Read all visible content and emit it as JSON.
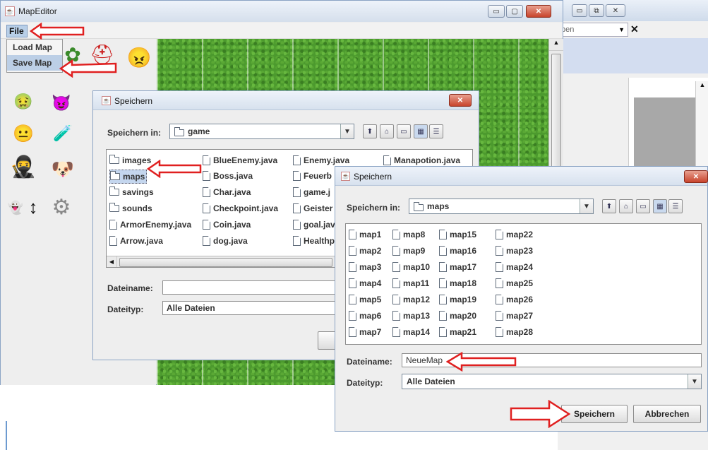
{
  "main_window": {
    "title": "MapEditor",
    "menu": {
      "file_label": "File",
      "items": [
        "Load Map",
        "Save Map"
      ]
    },
    "buttons": {
      "minimize": "▭",
      "maximize": "▢",
      "close": "✕"
    }
  },
  "background_window": {
    "combo_text": "ben",
    "buttons": {
      "minimize": "▭",
      "restore": "⧉",
      "close": "✕"
    }
  },
  "dialog1": {
    "title": "Speichern",
    "save_in_label": "Speichern in:",
    "save_in_value": "game",
    "files": [
      {
        "name": "images",
        "type": "folder"
      },
      {
        "name": "maps",
        "type": "folder"
      },
      {
        "name": "savings",
        "type": "folder"
      },
      {
        "name": "sounds",
        "type": "folder"
      },
      {
        "name": "ArmorEnemy.java",
        "type": "file"
      },
      {
        "name": "Arrow.java",
        "type": "file"
      },
      {
        "name": "BlueEnemy.java",
        "type": "file"
      },
      {
        "name": "Boss.java",
        "type": "file"
      },
      {
        "name": "Char.java",
        "type": "file"
      },
      {
        "name": "Checkpoint.java",
        "type": "file"
      },
      {
        "name": "Coin.java",
        "type": "file"
      },
      {
        "name": "dog.java",
        "type": "file"
      },
      {
        "name": "Enemy.java",
        "type": "file"
      },
      {
        "name": "Feuerb",
        "type": "file"
      },
      {
        "name": "game.j",
        "type": "file"
      },
      {
        "name": "Geister",
        "type": "file"
      },
      {
        "name": "goal.jav",
        "type": "file"
      },
      {
        "name": "Healthp",
        "type": "file"
      },
      {
        "name": "Manapotion.java",
        "type": "file"
      }
    ],
    "filename_label": "Dateiname:",
    "filename_value": "",
    "filetype_label": "Dateityp:",
    "filetype_value": "Alle Dateien"
  },
  "dialog2": {
    "title": "Speichern",
    "save_in_label": "Speichern in:",
    "save_in_value": "maps",
    "files": [
      "map1",
      "map2",
      "map3",
      "map4",
      "map5",
      "map6",
      "map7",
      "map8",
      "map9",
      "map10",
      "map11",
      "map12",
      "map13",
      "map14",
      "map15",
      "map16",
      "map17",
      "map18",
      "map19",
      "map20",
      "map21",
      "map22",
      "map23",
      "map24",
      "map25",
      "map26",
      "map27",
      "map28"
    ],
    "filename_label": "Dateiname:",
    "filename_value": "NeueMap",
    "filetype_label": "Dateityp:",
    "filetype_value": "Alle Dateien",
    "save_button": "Speichern",
    "cancel_button": "Abbrechen"
  },
  "colors": {
    "arrow": "#e02020",
    "title_bar": "#d7e1ee"
  }
}
